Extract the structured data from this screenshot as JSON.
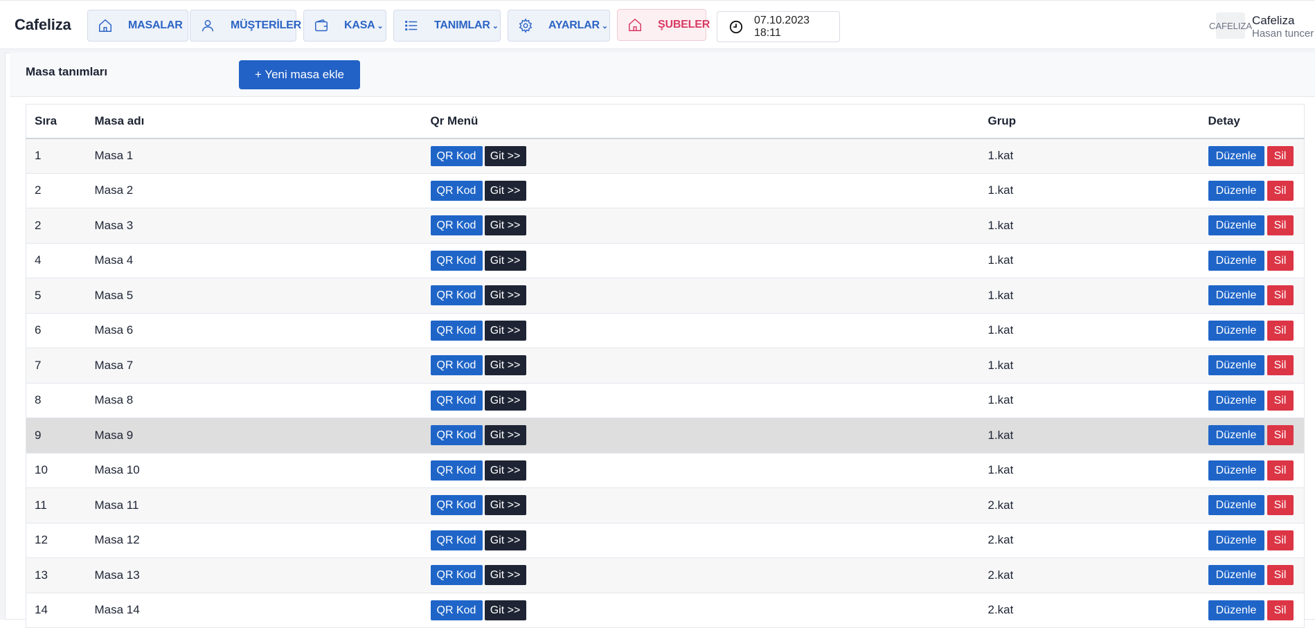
{
  "navbar": {
    "brand": "Cafeliza",
    "items": [
      {
        "label": "MASALAR",
        "icon": "home-icon",
        "dropdown": false
      },
      {
        "label": "MÜŞTERİLER",
        "icon": "user-icon",
        "dropdown": false
      },
      {
        "label": "KASA",
        "icon": "wallet-icon",
        "dropdown": true
      },
      {
        "label": "TANIMLAR",
        "icon": "list-icon",
        "dropdown": true
      },
      {
        "label": "AYARLAR",
        "icon": "gear-icon",
        "dropdown": true
      },
      {
        "label": "ŞUBELER",
        "icon": "home-icon",
        "dropdown": false
      }
    ],
    "datetime": "07.10.2023 18:11",
    "user": {
      "avatar_text": "CAFELIZA",
      "name": "Cafeliza",
      "subtitle": "Hasan tuncer"
    }
  },
  "page": {
    "title": "Masa tanımları",
    "add_button": "+ Yeni masa ekle"
  },
  "table": {
    "headers": [
      "Sıra",
      "Masa adı",
      "Qr Menü",
      "Grup",
      "Detay"
    ],
    "qr_label": "QR Kod",
    "git_label": "Git >>",
    "edit_label": "Düzenle",
    "delete_label": "Sil",
    "rows": [
      {
        "sira": "1",
        "ad": "Masa 1",
        "grup": "1.kat"
      },
      {
        "sira": "2",
        "ad": "Masa 2",
        "grup": "1.kat"
      },
      {
        "sira": "2",
        "ad": "Masa 3",
        "grup": "1.kat"
      },
      {
        "sira": "4",
        "ad": "Masa 4",
        "grup": "1.kat"
      },
      {
        "sira": "5",
        "ad": "Masa 5",
        "grup": "1.kat"
      },
      {
        "sira": "6",
        "ad": "Masa 6",
        "grup": "1.kat"
      },
      {
        "sira": "7",
        "ad": "Masa 7",
        "grup": "1.kat"
      },
      {
        "sira": "8",
        "ad": "Masa 8",
        "grup": "1.kat"
      },
      {
        "sira": "9",
        "ad": "Masa 9",
        "grup": "1.kat"
      },
      {
        "sira": "10",
        "ad": "Masa 10",
        "grup": "1.kat"
      },
      {
        "sira": "11",
        "ad": "Masa 11",
        "grup": "2.kat"
      },
      {
        "sira": "12",
        "ad": "Masa 12",
        "grup": "2.kat"
      },
      {
        "sira": "13",
        "ad": "Masa 13",
        "grup": "2.kat"
      },
      {
        "sira": "14",
        "ad": "Masa 14",
        "grup": "2.kat"
      }
    ],
    "highlighted_row": 8
  }
}
